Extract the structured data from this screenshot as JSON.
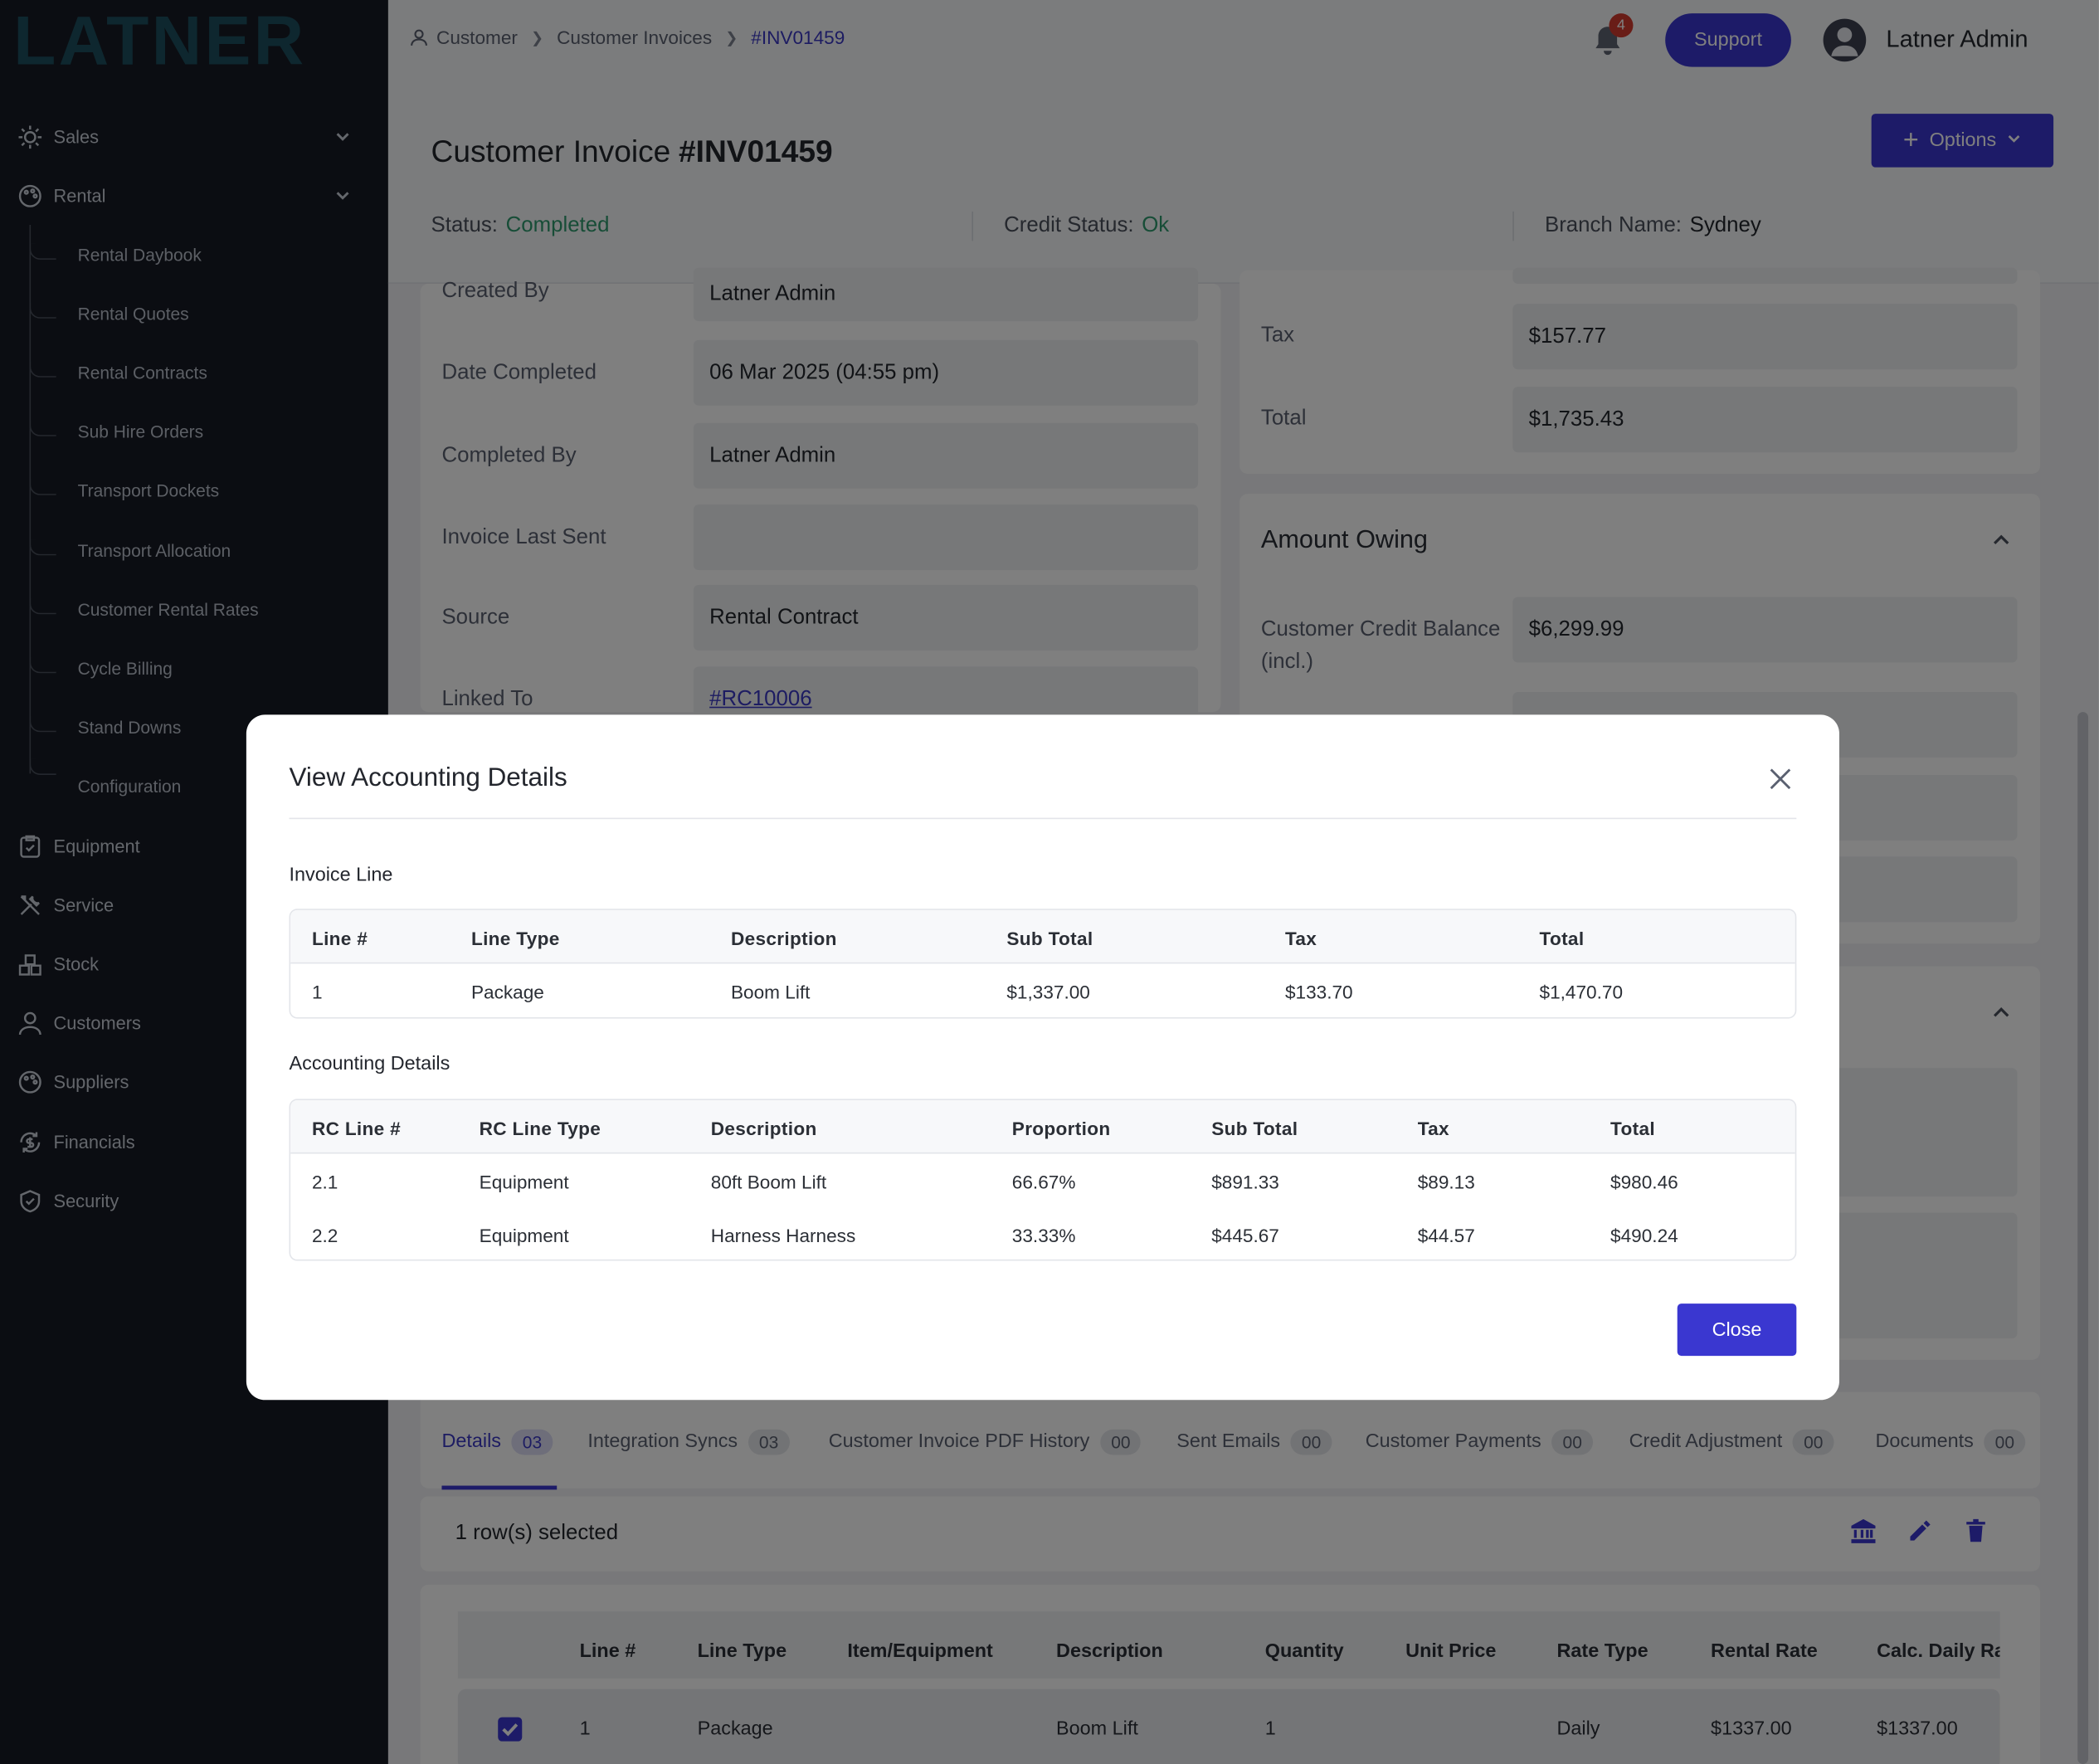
{
  "brand": {
    "logo_text": "LATNER"
  },
  "sidebar": {
    "items": [
      {
        "label": "Sales",
        "icon": "sun-gear-icon"
      },
      {
        "label": "Rental",
        "icon": "palette-icon"
      },
      {
        "label": "Equipment",
        "icon": "clipboard-check-icon"
      },
      {
        "label": "Service",
        "icon": "tools-icon"
      },
      {
        "label": "Stock",
        "icon": "cubes-icon"
      },
      {
        "label": "Customers",
        "icon": "user-icon"
      },
      {
        "label": "Suppliers",
        "icon": "palette-icon"
      },
      {
        "label": "Financials",
        "icon": "refresh-dollar-icon"
      },
      {
        "label": "Security",
        "icon": "shield-icon"
      }
    ],
    "rental_sub": [
      "Rental Daybook",
      "Rental Quotes",
      "Rental Contracts",
      "Sub Hire Orders",
      "Transport Dockets",
      "Transport Allocation",
      "Customer Rental Rates",
      "Cycle Billing",
      "Stand Downs",
      "Configuration"
    ]
  },
  "topbar": {
    "breadcrumb": [
      "Customer",
      "Customer Invoices",
      "#INV01459"
    ],
    "notification_count": "4",
    "support_label": "Support",
    "user_name": "Latner Admin"
  },
  "header": {
    "title_prefix": "Customer Invoice",
    "invoice_no": "#INV01459",
    "options_label": "Options",
    "status_label": "Status:",
    "status_value": "Completed",
    "credit_label": "Credit Status:",
    "credit_value": "Ok",
    "branch_label": "Branch Name:",
    "branch_value": "Sydney"
  },
  "details": {
    "fields": [
      {
        "label": "Created By",
        "value": "Latner Admin"
      },
      {
        "label": "Date Completed",
        "value": "06 Mar 2025 (04:55 pm)"
      },
      {
        "label": "Completed By",
        "value": "Latner Admin"
      },
      {
        "label": "Invoice Last Sent",
        "value": ""
      },
      {
        "label": "Source",
        "value": "Rental Contract"
      },
      {
        "label": "Linked To",
        "value": "#RC10006"
      }
    ]
  },
  "totals": {
    "tax_label": "Tax",
    "tax_value": "$157.77",
    "total_label": "Total",
    "total_value": "$1,735.43"
  },
  "amount_owing": {
    "title": "Amount Owing",
    "credit_balance_label": "Customer Credit Balance (incl.)",
    "credit_balance_value": "$6,299.99"
  },
  "tabs": [
    {
      "label": "Details",
      "count": "03"
    },
    {
      "label": "Integration Syncs",
      "count": "03"
    },
    {
      "label": "Customer Invoice PDF History",
      "count": "00"
    },
    {
      "label": "Sent Emails",
      "count": "00"
    },
    {
      "label": "Customer Payments",
      "count": "00"
    },
    {
      "label": "Credit Adjustment",
      "count": "00"
    },
    {
      "label": "Documents",
      "count": "00"
    }
  ],
  "grid": {
    "rows_selected": "1 row(s) selected",
    "headers": [
      "Line #",
      "Line Type",
      "Item/Equipment",
      "Description",
      "Quantity",
      "Unit Price",
      "Rate Type",
      "Rental Rate",
      "Calc. Daily Ra"
    ],
    "row": [
      "1",
      "Package",
      "",
      "Boom Lift",
      "1",
      "",
      "Daily",
      "$1337.00",
      "$1337.00"
    ]
  },
  "modal": {
    "title": "View Accounting Details",
    "invoice_line_title": "Invoice Line",
    "invoice_line_headers": [
      "Line #",
      "Line Type",
      "Description",
      "Sub Total",
      "Tax",
      "Total"
    ],
    "invoice_line_row": [
      "1",
      "Package",
      "Boom Lift",
      "$1,337.00",
      "$133.70",
      "$1,470.70"
    ],
    "accounting_title": "Accounting Details",
    "accounting_headers": [
      "RC Line #",
      "RC Line Type",
      "Description",
      "Proportion",
      "Sub Total",
      "Tax",
      "Total"
    ],
    "accounting_rows": [
      [
        "2.1",
        "Equipment",
        "80ft Boom Lift",
        "66.67%",
        "$891.33",
        "$89.13",
        "$980.46"
      ],
      [
        "2.2",
        "Equipment",
        "Harness Harness",
        "33.33%",
        "$445.67",
        "$44.57",
        "$490.24"
      ]
    ],
    "close_label": "Close"
  },
  "colors": {
    "accent": "#3a37d0",
    "success": "#2e9a6e",
    "sidebar_bg": "#161b24",
    "logo": "#1b5e6b"
  }
}
